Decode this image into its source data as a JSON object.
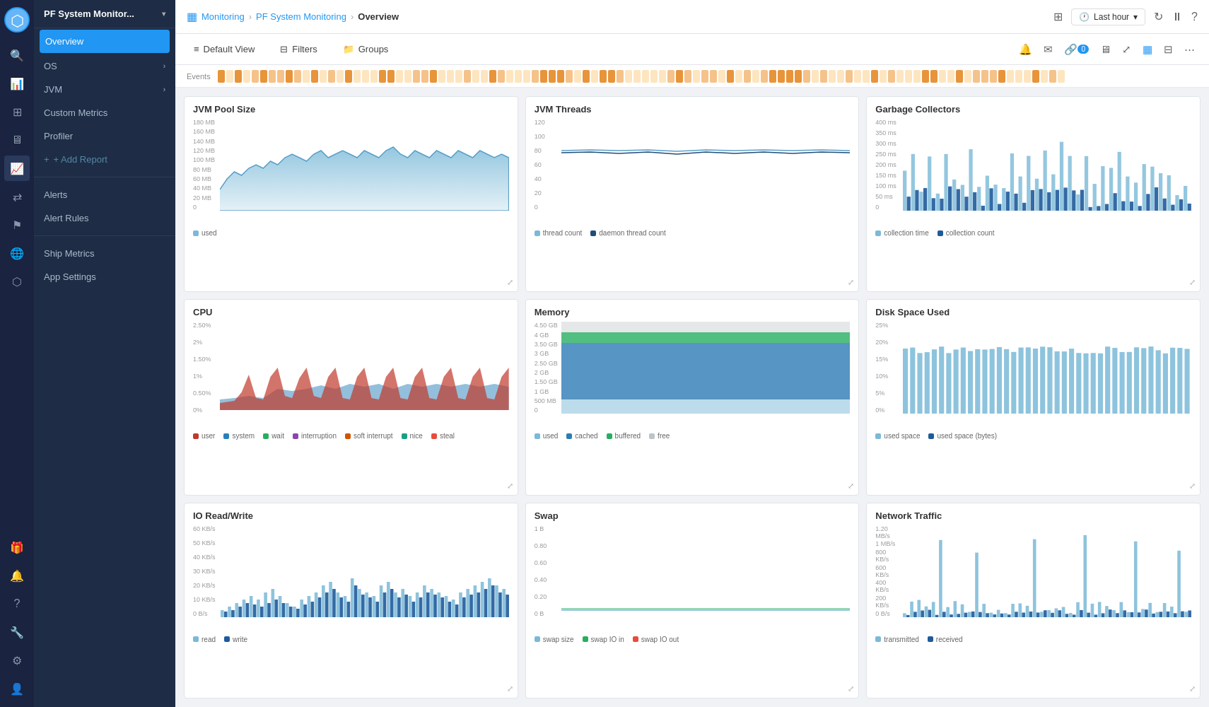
{
  "app": {
    "title": "PF System Monitor...",
    "logo_icon": "⬡"
  },
  "breadcrumb": {
    "items": [
      "Monitoring",
      "PF System Monitoring",
      "Overview"
    ]
  },
  "topbar": {
    "time_label": "Last hour",
    "icons": [
      "grid-icon",
      "clock-icon",
      "refresh-icon",
      "pause-icon",
      "help-icon"
    ]
  },
  "toolbar": {
    "view_label": "Default View",
    "filter_label": "Filters",
    "groups_label": "Groups"
  },
  "sidebar": {
    "nav_items": [
      {
        "label": "Overview",
        "active": true
      },
      {
        "label": "OS",
        "has_arrow": true
      },
      {
        "label": "JVM",
        "has_arrow": true
      },
      {
        "label": "Custom Metrics"
      },
      {
        "label": "Profiler"
      },
      {
        "label": "+ Add Report",
        "is_add": true
      }
    ],
    "bottom_items": [
      {
        "label": "Alerts"
      },
      {
        "label": "Alert Rules"
      }
    ],
    "section_items": [
      {
        "label": "Ship Metrics"
      },
      {
        "label": "App Settings"
      }
    ]
  },
  "charts": [
    {
      "id": "jvm-pool-size",
      "title": "JVM Pool Size",
      "legend": [
        {
          "label": "used",
          "color": "#7ab9d8"
        }
      ],
      "type": "area"
    },
    {
      "id": "jvm-threads",
      "title": "JVM Threads",
      "legend": [
        {
          "label": "thread count",
          "color": "#7ab9d8"
        },
        {
          "label": "daemon thread count",
          "color": "#1e4d7a"
        }
      ],
      "type": "line"
    },
    {
      "id": "garbage-collectors",
      "title": "Garbage Collectors",
      "legend": [
        {
          "label": "collection time",
          "color": "#7ab9d8"
        },
        {
          "label": "collection count",
          "color": "#1e5a9c"
        }
      ],
      "type": "bar"
    },
    {
      "id": "cpu",
      "title": "CPU",
      "legend": [
        {
          "label": "user",
          "color": "#c0392b"
        },
        {
          "label": "system",
          "color": "#2980b9"
        },
        {
          "label": "wait",
          "color": "#27ae60"
        },
        {
          "label": "interruption",
          "color": "#8e44ad"
        },
        {
          "label": "soft interrupt",
          "color": "#d35400"
        },
        {
          "label": "nice",
          "color": "#16a085"
        },
        {
          "label": "steal",
          "color": "#e74c3c"
        }
      ],
      "type": "area-multi"
    },
    {
      "id": "memory",
      "title": "Memory",
      "legend": [
        {
          "label": "used",
          "color": "#7ab9d8"
        },
        {
          "label": "cached",
          "color": "#2c7bb6"
        },
        {
          "label": "buffered",
          "color": "#27ae60"
        },
        {
          "label": "free",
          "color": "#bdc3c7"
        }
      ],
      "type": "stacked-area"
    },
    {
      "id": "disk-space",
      "title": "Disk Space Used",
      "legend": [
        {
          "label": "used space",
          "color": "#7ab9d8"
        },
        {
          "label": "used space (bytes)",
          "color": "#1e5a9c"
        }
      ],
      "type": "bar-dual"
    },
    {
      "id": "io-read-write",
      "title": "IO Read/Write",
      "legend": [
        {
          "label": "read",
          "color": "#7ab9d8"
        },
        {
          "label": "write",
          "color": "#1e5a9c"
        }
      ],
      "type": "bar"
    },
    {
      "id": "swap",
      "title": "Swap",
      "legend": [
        {
          "label": "swap size",
          "color": "#7ab9d8"
        },
        {
          "label": "swap IO in",
          "color": "#27ae60"
        },
        {
          "label": "swap IO out",
          "color": "#e74c3c"
        }
      ],
      "type": "line-flat"
    },
    {
      "id": "network-traffic",
      "title": "Network Traffic",
      "legend": [
        {
          "label": "transmitted",
          "color": "#7ab9d8"
        },
        {
          "label": "received",
          "color": "#1e5a9c"
        }
      ],
      "type": "bar-spike"
    }
  ],
  "events_label": "Events"
}
